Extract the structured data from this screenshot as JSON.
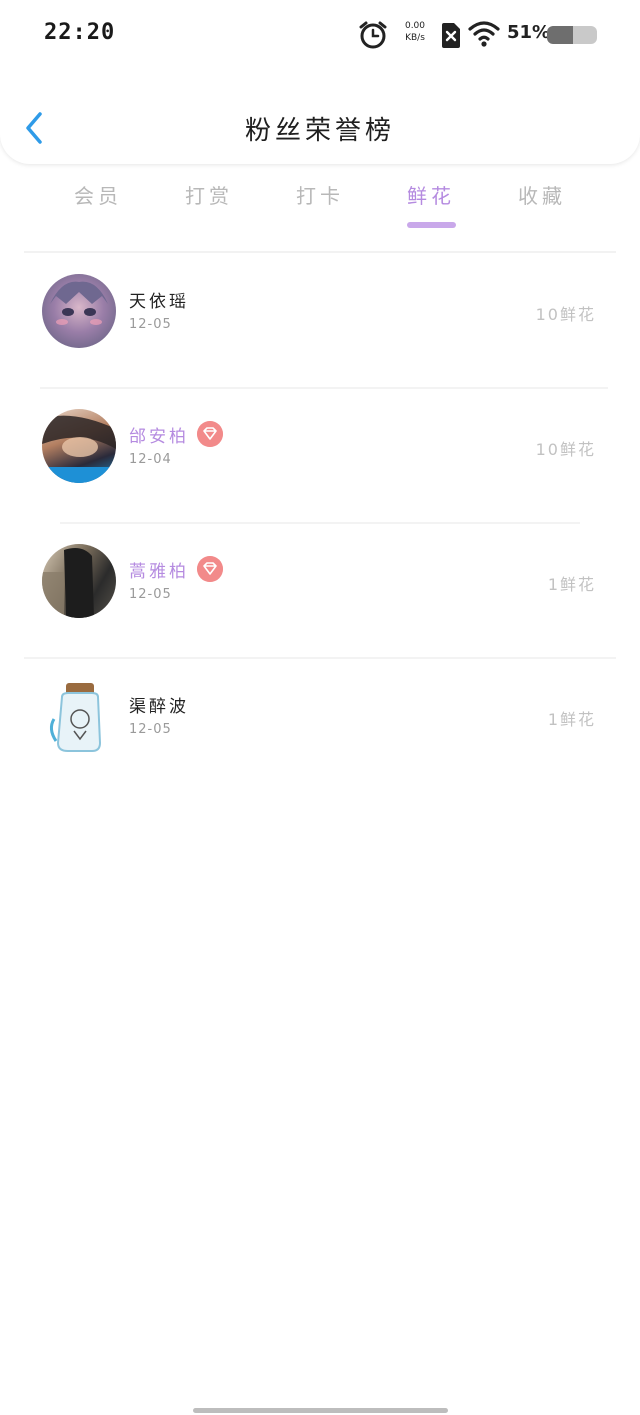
{
  "status_bar": {
    "time": "22:20",
    "net_speed_value": "0.00",
    "net_speed_unit": "KB/s",
    "battery_percent": "51%",
    "battery_level": 0.51
  },
  "header": {
    "title": "粉丝荣誉榜",
    "back_icon": "chevron-left-icon"
  },
  "tabs": [
    {
      "label": "会员",
      "active": false
    },
    {
      "label": "打赏",
      "active": false
    },
    {
      "label": "打卡",
      "active": false
    },
    {
      "label": "鲜花",
      "active": true
    },
    {
      "label": "收藏",
      "active": false
    }
  ],
  "fans": [
    {
      "name": "天依瑶",
      "date": "12-05",
      "count": "10鲜花",
      "vip": false
    },
    {
      "name": "邰安柏",
      "date": "12-04",
      "count": "10鲜花",
      "vip": true
    },
    {
      "name": "蒿雅柏",
      "date": "12-05",
      "count": "1鲜花",
      "vip": true
    },
    {
      "name": "渠醉波",
      "date": "12-05",
      "count": "1鲜花",
      "vip": false
    }
  ],
  "colors": {
    "accent": "#b58be0",
    "indicator": "#c9a8ea",
    "badge": "#f28a8a",
    "back_icon": "#2f9be8",
    "inactive_tab": "#b8b8b8"
  }
}
